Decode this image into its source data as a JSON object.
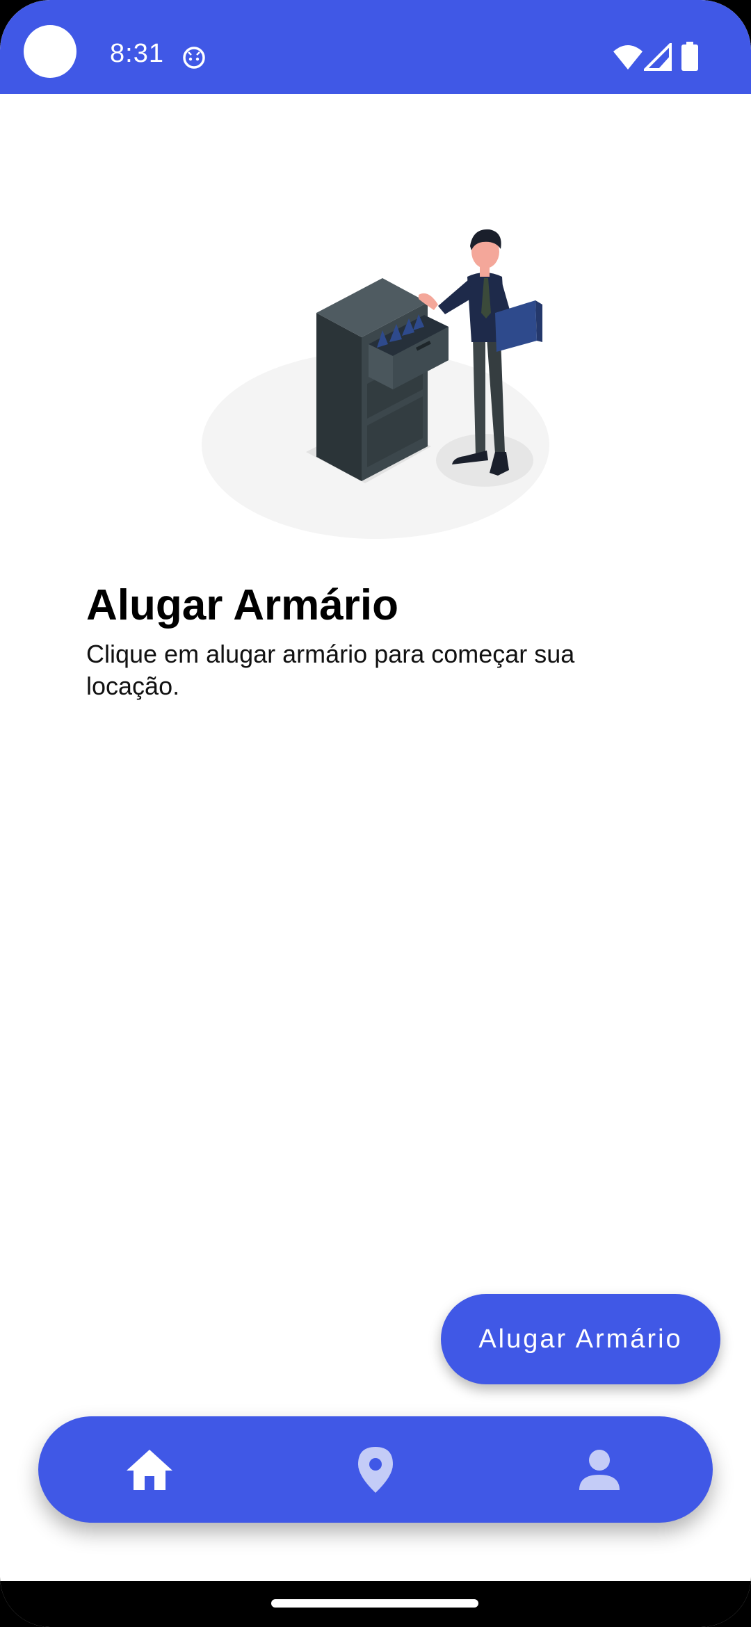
{
  "status_bar": {
    "time": "8:31",
    "background_color": "#4058E6",
    "icons": [
      "notification-face-icon",
      "wifi-icon",
      "signal-icon",
      "battery-icon"
    ]
  },
  "illustration": {
    "description_icon": "filing-cabinet-person-illustration"
  },
  "content": {
    "title": "Alugar Armário",
    "subtitle": "Clique em alugar armário para começar sua locação."
  },
  "action_button": {
    "label": "Alugar Armário",
    "color": "#4058E6"
  },
  "bottom_nav": {
    "color": "#4058E6",
    "items": [
      {
        "icon": "home-icon",
        "active": true
      },
      {
        "icon": "location-pin-icon",
        "active": false
      },
      {
        "icon": "person-icon",
        "active": false
      }
    ]
  }
}
